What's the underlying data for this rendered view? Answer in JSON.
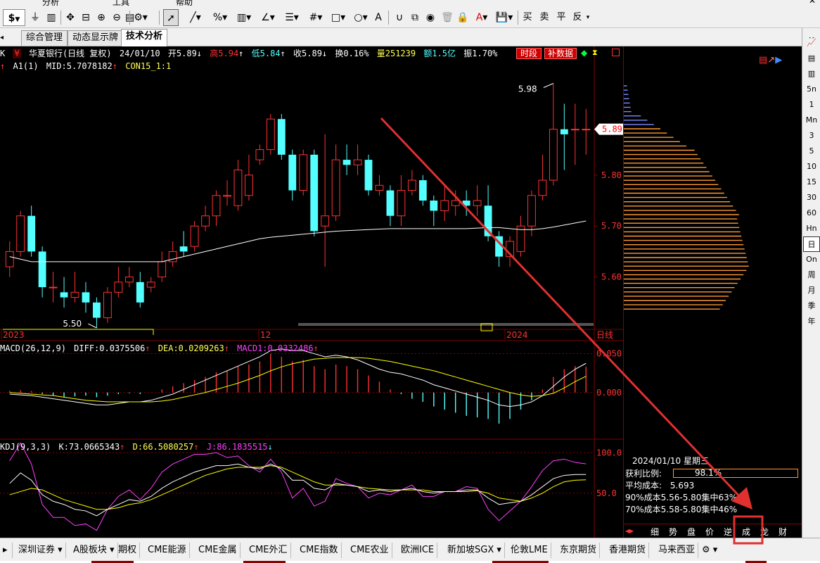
{
  "menubar": {
    "items": [
      "分析",
      "工具",
      "帮助"
    ]
  },
  "toolbar": {
    "currency_icon": "$",
    "buy_label": "买",
    "sell_label": "卖",
    "flat_label": "平",
    "reverse_label": "反",
    "text_tool": "A"
  },
  "tabs": [
    {
      "label": "综合管理"
    },
    {
      "label": "动态显示牌"
    },
    {
      "label": "技术分析"
    }
  ],
  "stock_header": {
    "k_label": "K",
    "name": "华夏银行(日线 复权)",
    "date": "24/01/10",
    "open": "开5.89",
    "high": "高5.94",
    "low": "低5.84",
    "close": "收5.89",
    "turnover": "换0.16%",
    "volume": "量251239",
    "amount": "额1.5亿",
    "amplitude": "振1.70%",
    "btn_time": "时段",
    "btn_supp": "补数据"
  },
  "ma_line": {
    "text1": "A1(1)",
    "text2": "MID:5.7078182",
    "text3": "CON15_1:1"
  },
  "macd_header": {
    "name": "MACD(26,12,9)",
    "diff": "DIFF:0.0375506",
    "dea": "DEA:0.0209263",
    "macd": "MACD1:0.0332486"
  },
  "kdj_header": {
    "name": "KDJ(9,3,3)",
    "k": "K:73.0665343",
    "d": "D:66.5080257",
    "j": "J:86.1835515"
  },
  "price_labels": {
    "high_mark": "5.98",
    "low_mark": "5.50",
    "current": "5.89"
  },
  "chart_data": {
    "type": "candlestick",
    "y_ticks": [
      "5.80",
      "5.70",
      "5.60"
    ],
    "macd_ticks": [
      "0.050",
      "0.000"
    ],
    "kdj_ticks": [
      "100.0",
      "50.0"
    ],
    "x_labels": [
      "2023",
      "12",
      "2024"
    ],
    "period_label": "日线",
    "candles": [
      {
        "o": 5.62,
        "c": 5.65,
        "h": 5.67,
        "l": 5.6
      },
      {
        "o": 5.65,
        "c": 5.72,
        "h": 5.73,
        "l": 5.64
      },
      {
        "o": 5.72,
        "c": 5.65,
        "h": 5.74,
        "l": 5.64
      },
      {
        "o": 5.65,
        "c": 5.58,
        "h": 5.66,
        "l": 5.56
      },
      {
        "o": 5.58,
        "c": 5.58,
        "h": 5.61,
        "l": 5.55
      },
      {
        "o": 5.57,
        "c": 5.56,
        "h": 5.6,
        "l": 5.54
      },
      {
        "o": 5.56,
        "c": 5.57,
        "h": 5.61,
        "l": 5.55
      },
      {
        "o": 5.57,
        "c": 5.55,
        "h": 5.59,
        "l": 5.53
      },
      {
        "o": 5.55,
        "c": 5.52,
        "h": 5.56,
        "l": 5.5
      },
      {
        "o": 5.52,
        "c": 5.57,
        "h": 5.58,
        "l": 5.51
      },
      {
        "o": 5.57,
        "c": 5.59,
        "h": 5.62,
        "l": 5.56
      },
      {
        "o": 5.59,
        "c": 5.6,
        "h": 5.62,
        "l": 5.58
      },
      {
        "o": 5.59,
        "c": 5.55,
        "h": 5.61,
        "l": 5.54
      },
      {
        "o": 5.58,
        "c": 5.59,
        "h": 5.6,
        "l": 5.57
      },
      {
        "o": 5.6,
        "c": 5.63,
        "h": 5.65,
        "l": 5.59
      },
      {
        "o": 5.63,
        "c": 5.65,
        "h": 5.67,
        "l": 5.62
      },
      {
        "o": 5.66,
        "c": 5.65,
        "h": 5.69,
        "l": 5.64
      },
      {
        "o": 5.66,
        "c": 5.7,
        "h": 5.71,
        "l": 5.65
      },
      {
        "o": 5.7,
        "c": 5.72,
        "h": 5.74,
        "l": 5.69
      },
      {
        "o": 5.72,
        "c": 5.76,
        "h": 5.77,
        "l": 5.7
      },
      {
        "o": 5.76,
        "c": 5.76,
        "h": 5.79,
        "l": 5.74
      },
      {
        "o": 5.74,
        "c": 5.81,
        "h": 5.83,
        "l": 5.73
      },
      {
        "o": 5.76,
        "c": 5.8,
        "h": 5.84,
        "l": 5.75
      },
      {
        "o": 5.83,
        "c": 5.85,
        "h": 5.86,
        "l": 5.82
      },
      {
        "o": 5.85,
        "c": 5.91,
        "h": 5.92,
        "l": 5.84
      },
      {
        "o": 5.91,
        "c": 5.84,
        "h": 5.92,
        "l": 5.83
      },
      {
        "o": 5.84,
        "c": 5.77,
        "h": 5.85,
        "l": 5.75
      },
      {
        "o": 5.77,
        "c": 5.84,
        "h": 5.85,
        "l": 5.76
      },
      {
        "o": 5.84,
        "c": 5.69,
        "h": 5.85,
        "l": 5.68
      },
      {
        "o": 5.7,
        "c": 5.72,
        "h": 5.88,
        "l": 5.62
      },
      {
        "o": 5.72,
        "c": 5.83,
        "h": 5.86,
        "l": 5.71
      },
      {
        "o": 5.83,
        "c": 5.82,
        "h": 5.86,
        "l": 5.8
      },
      {
        "o": 5.82,
        "c": 5.83,
        "h": 5.86,
        "l": 5.8
      },
      {
        "o": 5.83,
        "c": 5.77,
        "h": 5.84,
        "l": 5.76
      },
      {
        "o": 5.77,
        "c": 5.78,
        "h": 5.8,
        "l": 5.76
      },
      {
        "o": 5.77,
        "c": 5.72,
        "h": 5.78,
        "l": 5.7
      },
      {
        "o": 5.72,
        "c": 5.77,
        "h": 5.8,
        "l": 5.7
      },
      {
        "o": 5.77,
        "c": 5.79,
        "h": 5.81,
        "l": 5.76
      },
      {
        "o": 5.79,
        "c": 5.75,
        "h": 5.8,
        "l": 5.74
      },
      {
        "o": 5.75,
        "c": 5.73,
        "h": 5.76,
        "l": 5.7
      },
      {
        "o": 5.73,
        "c": 5.75,
        "h": 5.78,
        "l": 5.71
      },
      {
        "o": 5.74,
        "c": 5.75,
        "h": 5.77,
        "l": 5.72
      },
      {
        "o": 5.75,
        "c": 5.74,
        "h": 5.77,
        "l": 5.72
      },
      {
        "o": 5.74,
        "c": 5.75,
        "h": 5.78,
        "l": 5.72
      },
      {
        "o": 5.74,
        "c": 5.68,
        "h": 5.78,
        "l": 5.67
      },
      {
        "o": 5.68,
        "c": 5.64,
        "h": 5.69,
        "l": 5.62
      },
      {
        "o": 5.64,
        "c": 5.67,
        "h": 5.68,
        "l": 5.62
      },
      {
        "o": 5.65,
        "c": 5.7,
        "h": 5.72,
        "l": 5.64
      },
      {
        "o": 5.7,
        "c": 5.76,
        "h": 5.77,
        "l": 5.68
      },
      {
        "o": 5.76,
        "c": 5.79,
        "h": 5.84,
        "l": 5.75
      },
      {
        "o": 5.79,
        "c": 5.89,
        "h": 5.98,
        "l": 5.78
      },
      {
        "o": 5.89,
        "c": 5.88,
        "h": 5.94,
        "l": 5.81
      },
      {
        "o": 5.89,
        "c": 5.89,
        "h": 5.94,
        "l": 5.82
      },
      {
        "o": 5.89,
        "c": 5.89,
        "h": 5.93,
        "l": 5.84
      }
    ],
    "ma": [
      5.64,
      5.635,
      5.63,
      5.63,
      5.63,
      5.63,
      5.63,
      5.63,
      5.63,
      5.63,
      5.63,
      5.63,
      5.63,
      5.63,
      5.63,
      5.635,
      5.64,
      5.645,
      5.65,
      5.655,
      5.66,
      5.665,
      5.67,
      5.675,
      5.678,
      5.68,
      5.682,
      5.684,
      5.686,
      5.688,
      5.69,
      5.691,
      5.692,
      5.693,
      5.694,
      5.695,
      5.695,
      5.695,
      5.695,
      5.695,
      5.695,
      5.695,
      5.695,
      5.696,
      5.697,
      5.697,
      5.695,
      5.693,
      5.693,
      5.695,
      5.698,
      5.702,
      5.706,
      5.71
    ],
    "macd_hist": [
      0.002,
      0.003,
      0.002,
      -0.002,
      -0.004,
      -0.006,
      -0.005,
      -0.004,
      -0.006,
      -0.004,
      -0.002,
      -0.001,
      -0.002,
      0.0,
      0.004,
      0.008,
      0.012,
      0.016,
      0.02,
      0.026,
      0.028,
      0.034,
      0.036,
      0.04,
      0.05,
      0.046,
      0.04,
      0.042,
      0.034,
      0.03,
      0.036,
      0.034,
      0.03,
      0.022,
      0.014,
      0.004,
      -0.002,
      -0.008,
      -0.012,
      -0.018,
      -0.022,
      -0.026,
      -0.03,
      -0.032,
      -0.034,
      -0.04,
      -0.034,
      -0.022,
      -0.01,
      0.004,
      0.02,
      0.03,
      0.034,
      0.0332
    ],
    "macd_diff": [
      -0.002,
      -0.003,
      -0.004,
      -0.006,
      -0.008,
      -0.01,
      -0.012,
      -0.014,
      -0.016,
      -0.016,
      -0.014,
      -0.012,
      -0.012,
      -0.01,
      -0.006,
      -0.002,
      0.004,
      0.01,
      0.016,
      0.022,
      0.028,
      0.034,
      0.04,
      0.046,
      0.054,
      0.056,
      0.054,
      0.054,
      0.05,
      0.046,
      0.048,
      0.046,
      0.042,
      0.036,
      0.03,
      0.026,
      0.024,
      0.02,
      0.016,
      0.01,
      0.006,
      0.002,
      -0.002,
      -0.006,
      -0.01,
      -0.016,
      -0.018,
      -0.016,
      -0.012,
      -0.004,
      0.008,
      0.02,
      0.03,
      0.0376
    ],
    "macd_dea": [
      0.0,
      -0.001,
      -0.002,
      -0.003,
      -0.004,
      -0.006,
      -0.008,
      -0.01,
      -0.011,
      -0.012,
      -0.012,
      -0.012,
      -0.012,
      -0.012,
      -0.011,
      -0.009,
      -0.006,
      -0.003,
      0.0,
      0.004,
      0.008,
      0.012,
      0.017,
      0.022,
      0.028,
      0.033,
      0.037,
      0.04,
      0.043,
      0.044,
      0.045,
      0.045,
      0.045,
      0.044,
      0.042,
      0.04,
      0.037,
      0.034,
      0.031,
      0.028,
      0.024,
      0.02,
      0.016,
      0.012,
      0.008,
      0.004,
      0.0,
      -0.003,
      -0.005,
      -0.004,
      -0.001,
      0.006,
      0.014,
      0.0209
    ],
    "kdj_k": [
      62,
      75,
      66,
      48,
      40,
      36,
      30,
      28,
      22,
      30,
      36,
      42,
      40,
      46,
      56,
      64,
      70,
      76,
      80,
      84,
      84,
      86,
      82,
      80,
      86,
      80,
      66,
      66,
      56,
      54,
      62,
      60,
      58,
      52,
      54,
      52,
      54,
      56,
      52,
      50,
      52,
      52,
      54,
      54,
      44,
      36,
      38,
      40,
      48,
      58,
      68,
      72,
      73,
      73.07
    ],
    "kdj_d": [
      48,
      52,
      56,
      54,
      48,
      42,
      38,
      34,
      30,
      30,
      32,
      36,
      38,
      42,
      48,
      54,
      60,
      66,
      72,
      76,
      80,
      82,
      82,
      82,
      84,
      82,
      76,
      70,
      64,
      60,
      60,
      60,
      58,
      56,
      55,
      54,
      54,
      54,
      54,
      52,
      52,
      52,
      52,
      53,
      50,
      44,
      42,
      40,
      44,
      50,
      58,
      64,
      66,
      66.51
    ],
    "kdj_j": [
      90,
      120,
      86,
      36,
      20,
      20,
      10,
      12,
      4,
      30,
      46,
      54,
      42,
      56,
      76,
      86,
      92,
      98,
      98,
      100,
      94,
      96,
      84,
      76,
      92,
      76,
      44,
      56,
      34,
      40,
      68,
      62,
      58,
      44,
      50,
      48,
      54,
      60,
      46,
      46,
      52,
      52,
      58,
      56,
      30,
      16,
      28,
      40,
      58,
      78,
      90,
      92,
      88,
      86.18
    ]
  },
  "cost_panel": {
    "date": "2024/01/10 星期三",
    "profit_label": "获利比例:",
    "profit_value": "98.1%",
    "avg_label": "平均成本:",
    "avg_value": "5.693",
    "c90": "90%成本5.56-5.80集中63%",
    "c70": "70%成本5.58-5.80集中46%",
    "bottom_tabs": [
      "细",
      "势",
      "盘",
      "价",
      "逆",
      "成",
      "龙",
      "财"
    ]
  },
  "vbar_items": [
    "1m",
    "5m",
    "15m",
    "30m",
    "60m",
    "Hn",
    "日",
    "On",
    "周",
    "月",
    "季",
    "年"
  ],
  "vbar_labels": [
    "1",
    "Mn",
    "3",
    "5",
    "10",
    "15",
    "30",
    "60",
    "Hn",
    "日",
    "On",
    "周",
    "月",
    "季",
    "年"
  ],
  "market_tabs": [
    "深圳证券",
    "A股板块",
    "期权",
    "CME能源",
    "CME金属",
    "CME外汇",
    "CME指数",
    "CME农业",
    "欧洲ICE",
    "新加坡SGX",
    "伦敦LME",
    "东京期货",
    "香港期货",
    "马来西亚"
  ],
  "colors": {
    "up": "#ff3232",
    "down": "#54ffff",
    "bg": "#000000",
    "grid": "#800000",
    "ma": "#ffffff",
    "diff": "#ffffff",
    "dea": "#ffff00",
    "j": "#ff40ff",
    "cost": "#ff9933",
    "cost_up": "#7b8cff",
    "annot": "#e03030"
  }
}
